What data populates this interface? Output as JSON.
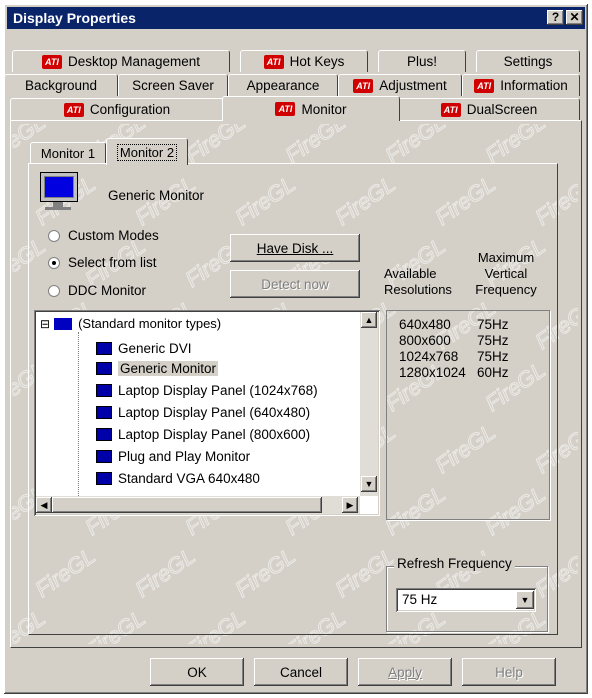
{
  "window": {
    "title": "Display Properties",
    "help_btn": "?",
    "close_btn": "✕"
  },
  "tabs": {
    "row1": [
      {
        "label": "Desktop Management",
        "ati": true
      },
      {
        "label": "Hot Keys",
        "ati": true
      },
      {
        "label": "Plus!",
        "ati": false
      },
      {
        "label": "Settings",
        "ati": false
      }
    ],
    "row2": [
      {
        "label": "Background",
        "ati": false
      },
      {
        "label": "Screen Saver",
        "ati": false
      },
      {
        "label": "Appearance",
        "ati": false
      },
      {
        "label": "Adjustment",
        "ati": true
      },
      {
        "label": "Information",
        "ati": true
      }
    ],
    "row3": [
      {
        "label": "Configuration",
        "ati": true
      },
      {
        "label": "Monitor",
        "ati": true,
        "active": true
      },
      {
        "label": "DualScreen",
        "ati": true
      }
    ]
  },
  "ati_logo_text": "ATI",
  "subtabs": [
    "Monitor 1",
    "Monitor 2"
  ],
  "active_subtab": "Monitor 2",
  "monitor_name": "Generic Monitor",
  "modes": [
    {
      "label": "Custom Modes",
      "selected": false
    },
    {
      "label": "Select from list",
      "selected": true
    },
    {
      "label": "DDC Monitor",
      "selected": false
    }
  ],
  "buttons": {
    "have_disk": "Have Disk ...",
    "detect_now": "Detect now",
    "ok": "OK",
    "cancel": "Cancel",
    "apply": "Apply",
    "help": "Help"
  },
  "tree": {
    "root": "(Standard monitor types)",
    "expander": "⊟",
    "items": [
      "Generic DVI",
      "Generic Monitor",
      "Laptop Display Panel (1024x768)",
      "Laptop Display Panel (640x480)",
      "Laptop Display Panel (800x600)",
      "Plug and Play Monitor",
      "Standard VGA 640x480"
    ],
    "selected": "Generic Monitor"
  },
  "resolutions": {
    "header_res": "Available Resolutions",
    "header_freq": "Maximum Vertical Frequency",
    "rows": [
      {
        "res": "640x480",
        "freq": "75Hz"
      },
      {
        "res": "800x600",
        "freq": "75Hz"
      },
      {
        "res": "1024x768",
        "freq": "75Hz"
      },
      {
        "res": "1280x1024",
        "freq": "60Hz"
      }
    ]
  },
  "refresh": {
    "group_label": "Refresh Frequency",
    "value": "75 Hz"
  },
  "watermark": "FireGL",
  "colors": {
    "titlebar": "#0a246a",
    "ati_red": "#d00000",
    "face": "#d4d0c8"
  }
}
